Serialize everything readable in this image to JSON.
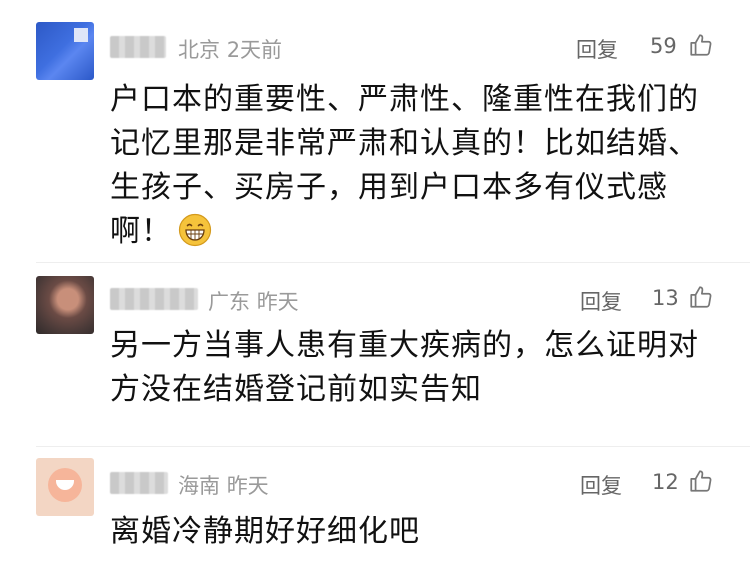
{
  "comments": [
    {
      "location": "北京",
      "time": "2天前",
      "reply_label": "回复",
      "likes": "59",
      "text": "户口本的重要性、严肃性、隆重性在我们的记忆里那是非常严肃和认真的！比如结婚、生孩子、买房子，用到户口本多有仪式感啊！"
    },
    {
      "location": "广东",
      "time": "昨天",
      "reply_label": "回复",
      "likes": "13",
      "text": "另一方当事人患有重大疾病的，怎么证明对方没在结婚登记前如实告知"
    },
    {
      "location": "海南",
      "time": "昨天",
      "reply_label": "回复",
      "likes": "12",
      "text": "离婚冷静期好好细化吧"
    }
  ],
  "icons": {
    "thumb": "thumbs-up-icon",
    "emoji": "grinning-face-icon"
  },
  "colors": {
    "meta": "#9a9a9a",
    "text": "#111111",
    "emoji": "#f5c33b"
  }
}
